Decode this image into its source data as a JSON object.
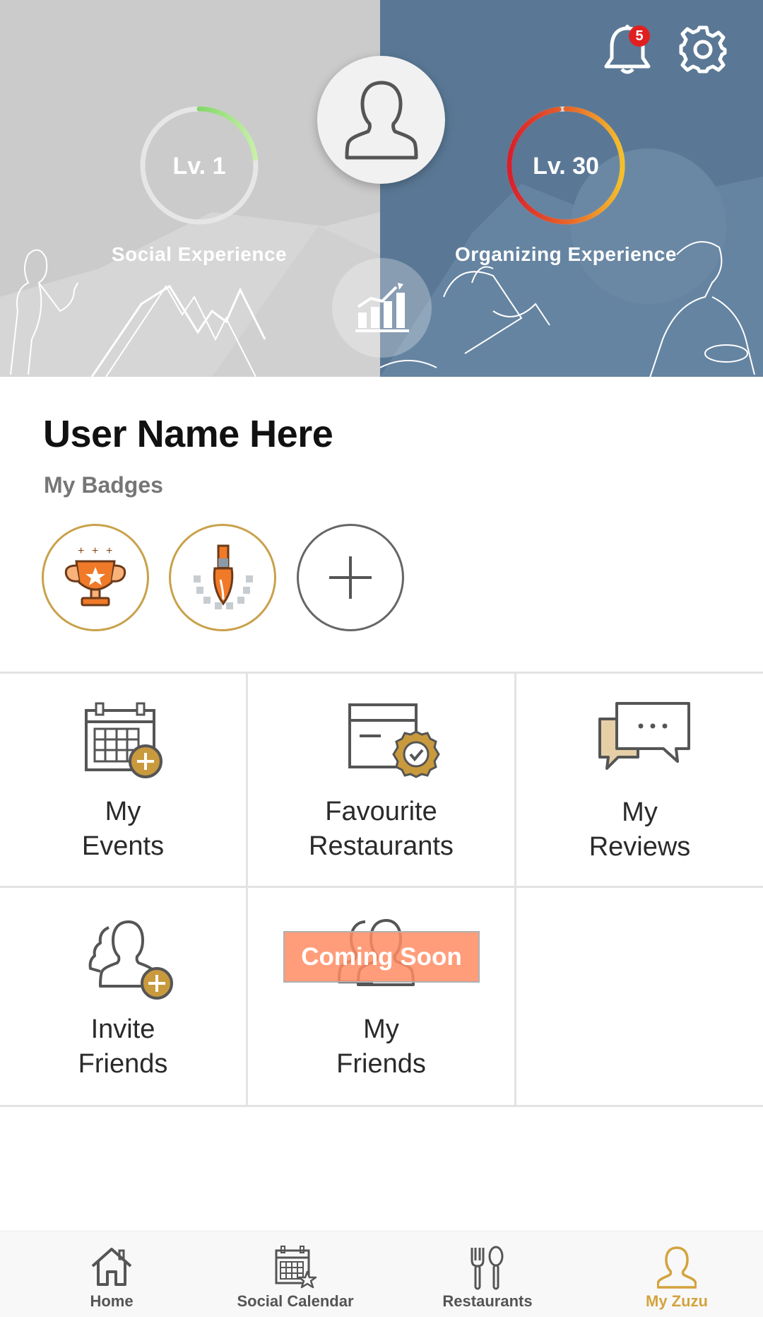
{
  "header": {
    "notification_count": "5",
    "social": {
      "level": "Lv. 1",
      "label": "Social Experience",
      "progress": 0.23
    },
    "organizing": {
      "level": "Lv. 30",
      "label": "Organizing Experience",
      "progress": 0.98
    }
  },
  "profile": {
    "username": "User Name Here",
    "badges_title": "My Badges",
    "badges": [
      "trophy-badge",
      "brush-badge"
    ],
    "add_badge_icon": "plus-icon"
  },
  "menu": {
    "my_events": {
      "line1": "My",
      "line2": "Events"
    },
    "favourite_restaurants": {
      "line1": "Favourite",
      "line2": "Restaurants"
    },
    "my_reviews": {
      "line1": "My",
      "line2": "Reviews"
    },
    "invite_friends": {
      "line1": "Invite",
      "line2": "Friends"
    },
    "my_friends": {
      "line1": "My",
      "line2": "Friends",
      "overlay": "Coming Soon"
    }
  },
  "nav": {
    "items": [
      {
        "label": "Home",
        "icon": "home-icon"
      },
      {
        "label": "Social Calendar",
        "icon": "calendar-icon"
      },
      {
        "label": "Restaurants",
        "icon": "fork-spoon-icon"
      },
      {
        "label": "My Zuzu",
        "icon": "person-icon"
      }
    ],
    "active_index": 3
  },
  "colors": {
    "left_panel": "#cbcbcb",
    "right_panel": "#5a7895",
    "accent_gold": "#d4a33e",
    "badge_notification": "#e02020",
    "coming_soon": "#ff8c64"
  }
}
